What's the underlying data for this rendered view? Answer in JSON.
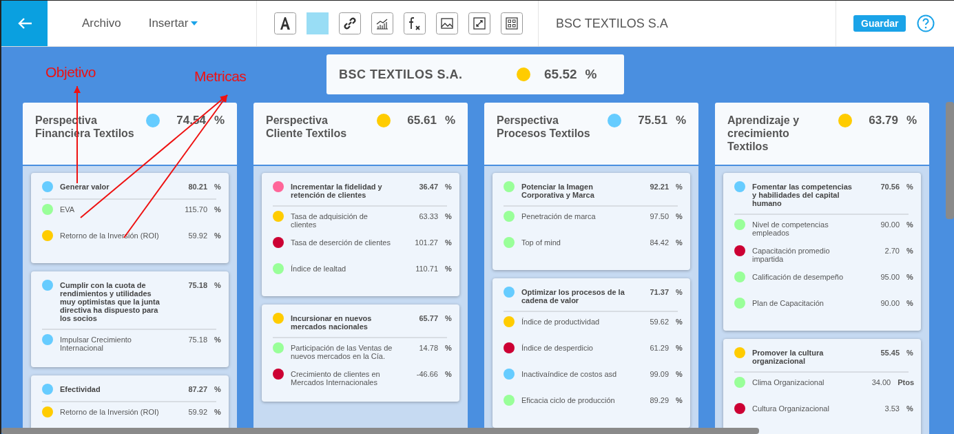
{
  "toolbar": {
    "menus": [
      {
        "label": "Archivo",
        "dropdown": false
      },
      {
        "label": "Insertar",
        "dropdown": true
      }
    ],
    "document_title": "BSC TEXTILOS S.A",
    "save_button": "Guardar"
  },
  "summary": {
    "title": "BSC TEXTILOS S.A.",
    "value": "65.52",
    "unit": "%",
    "color": "#ffcc00"
  },
  "perspectives": [
    {
      "title": "Perspectiva Financiera Textilos",
      "value": "74.54",
      "unit": "%",
      "color": "#66ccff",
      "objectives": [
        {
          "name": "Generar valor",
          "value": "80.21",
          "unit": "%",
          "color": "#66ccff",
          "metrics": [
            {
              "name": "EVA",
              "value": "115.70",
              "unit": "%",
              "color": "#99ff99"
            },
            {
              "name": "Retorno de la Inversión (ROI)",
              "value": "59.92",
              "unit": "%",
              "color": "#ffcc00"
            }
          ]
        },
        {
          "name": "Cumplir con la cuota de rendimientos y utilidades muy optimistas que la junta directiva ha dispuesto para los socios",
          "value": "75.18",
          "unit": "%",
          "color": "#66ccff",
          "metrics": [
            {
              "name": "Impulsar Crecimiento Internacional",
              "value": "75.18",
              "unit": "%",
              "color": "#66ccff"
            }
          ]
        },
        {
          "name": "Efectividad",
          "value": "87.27",
          "unit": "%",
          "color": "#66ccff",
          "metrics": [
            {
              "name": "Retorno de la Inversión (ROI)",
              "value": "59.92",
              "unit": "%",
              "color": "#ffcc00"
            }
          ]
        }
      ]
    },
    {
      "title": "Perspectiva Cliente Textilos",
      "value": "65.61",
      "unit": "%",
      "color": "#ffcc00",
      "objectives": [
        {
          "name": "Incrementar la fidelidad y retención de clientes",
          "value": "36.47",
          "unit": "%",
          "color": "#ff6699",
          "metrics": [
            {
              "name": "Tasa de adquisición de clientes",
              "value": "63.33",
              "unit": "%",
              "color": "#ffcc00"
            },
            {
              "name": "Tasa de deserción de clientes",
              "value": "101.27",
              "unit": "%",
              "color": "#cc0033"
            },
            {
              "name": "Índice de lealtad",
              "value": "110.71",
              "unit": "%",
              "color": "#99ff99"
            }
          ]
        },
        {
          "name": "Incursionar en nuevos mercados nacionales",
          "value": "65.77",
          "unit": "%",
          "color": "#ffcc00",
          "metrics": [
            {
              "name": "Participación de las Ventas de nuevos mercados en la Cía.",
              "value": "14.78",
              "unit": "%",
              "color": "#99ff99"
            },
            {
              "name": "Crecimiento de clientes en Mercados Internacionales",
              "value": "-46.66",
              "unit": "%",
              "color": "#cc0033"
            }
          ]
        }
      ]
    },
    {
      "title": "Perspectiva Procesos Textilos",
      "value": "75.51",
      "unit": "%",
      "color": "#66ccff",
      "objectives": [
        {
          "name": "Potenciar la Imagen Corporativa y Marca",
          "value": "92.21",
          "unit": "%",
          "color": "#99ff99",
          "metrics": [
            {
              "name": "Penetración de marca",
              "value": "97.50",
              "unit": "%",
              "color": "#99ff99"
            },
            {
              "name": "Top of mind",
              "value": "84.42",
              "unit": "%",
              "color": "#99ff99"
            }
          ]
        },
        {
          "name": "Optimizar los procesos de la cadena de valor",
          "value": "71.37",
          "unit": "%",
          "color": "#66ccff",
          "metrics": [
            {
              "name": "Índice de productividad",
              "value": "59.62",
              "unit": "%",
              "color": "#ffcc00"
            },
            {
              "name": "Índice de desperdicio",
              "value": "61.29",
              "unit": "%",
              "color": "#cc0033"
            },
            {
              "name": "Inactivaíndice de costos asd",
              "value": "99.09",
              "unit": "%",
              "color": "#66ccff"
            },
            {
              "name": "Eficacia ciclo de producción",
              "value": "89.29",
              "unit": "%",
              "color": "#99ff99"
            }
          ]
        }
      ]
    },
    {
      "title": "Aprendizaje y crecimiento Textilos",
      "value": "63.79",
      "unit": "%",
      "color": "#ffcc00",
      "objectives": [
        {
          "name": "Fomentar las competencias y habilidades del capital humano",
          "value": "70.56",
          "unit": "%",
          "color": "#66ccff",
          "metrics": [
            {
              "name": "Nivel de competencias empleados",
              "value": "90.00",
              "unit": "%",
              "color": "#99ff99"
            },
            {
              "name": "Capacitación promedio impartida",
              "value": "2.70",
              "unit": "%",
              "color": "#cc0033"
            },
            {
              "name": "Calificación de desempeño",
              "value": "95.00",
              "unit": "%",
              "color": "#99ff99"
            },
            {
              "name": "Plan de Capacitación",
              "value": "90.00",
              "unit": "%",
              "color": "#99ff99"
            }
          ]
        },
        {
          "name": "Promover la cultura organizacional",
          "value": "55.45",
          "unit": "%",
          "color": "#ffcc00",
          "metrics": [
            {
              "name": "Clima Organizacional",
              "value": "34.00",
              "unit": "Ptos",
              "color": "#99ff99"
            },
            {
              "name": "Cultura Organizacional",
              "value": "3.53",
              "unit": "%",
              "color": "#cc0033"
            }
          ]
        }
      ]
    }
  ],
  "annotations": [
    {
      "kind": "objective",
      "label": "Objetivo"
    },
    {
      "kind": "metrics",
      "label": "Metricas"
    }
  ]
}
